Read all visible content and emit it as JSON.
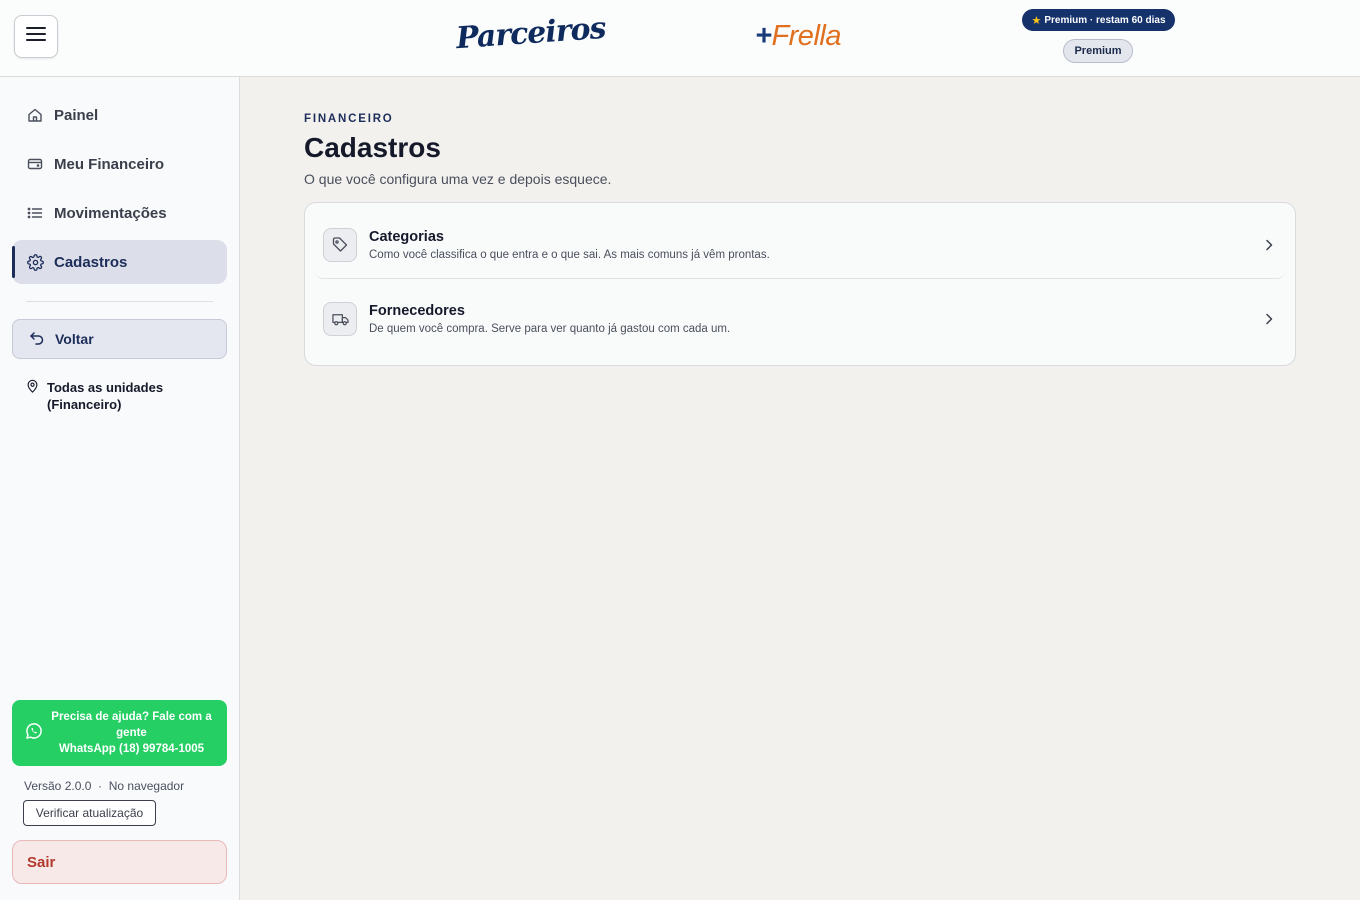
{
  "header": {
    "brand_primary": "Parceiros",
    "brand_secondary_plus": "+",
    "brand_secondary": "Frella",
    "premium_badge": "Premium · restam 60 dias",
    "plan_pill": "Premium"
  },
  "sidebar": {
    "items": [
      {
        "label": "Painel",
        "icon": "home-icon"
      },
      {
        "label": "Meu Financeiro",
        "icon": "wallet-icon"
      },
      {
        "label": "Movimentações",
        "icon": "list-icon"
      },
      {
        "label": "Cadastros",
        "icon": "gear-icon",
        "active": true
      }
    ],
    "back_label": "Voltar",
    "unit_label": "Todas as unidades (Financeiro)",
    "help": {
      "line1": "Precisa de ajuda? Fale com a gente",
      "line2": "WhatsApp (18) 99784-1005"
    },
    "version_text": "Versão 2.0.0  ·  No navegador",
    "verify_label": "Verificar atualização",
    "logout_label": "Sair"
  },
  "main": {
    "eyebrow": "FINANCEIRO",
    "title": "Cadastros",
    "subtitle": "O que você configura uma vez e depois esquece.",
    "rows": [
      {
        "title": "Categorias",
        "desc": "Como você classifica o que entra e o que sai. As mais comuns já vêm prontas.",
        "icon": "tag-icon"
      },
      {
        "title": "Fornecedores",
        "desc": "De quem você compra. Serve para ver quanto já gastou com cada um.",
        "icon": "truck-icon"
      }
    ]
  },
  "colors": {
    "brand_navy": "#1d2d5a",
    "accent_orange": "#e0701f",
    "whatsapp_green": "#25cf64",
    "logout_red": "#b23a2e"
  }
}
